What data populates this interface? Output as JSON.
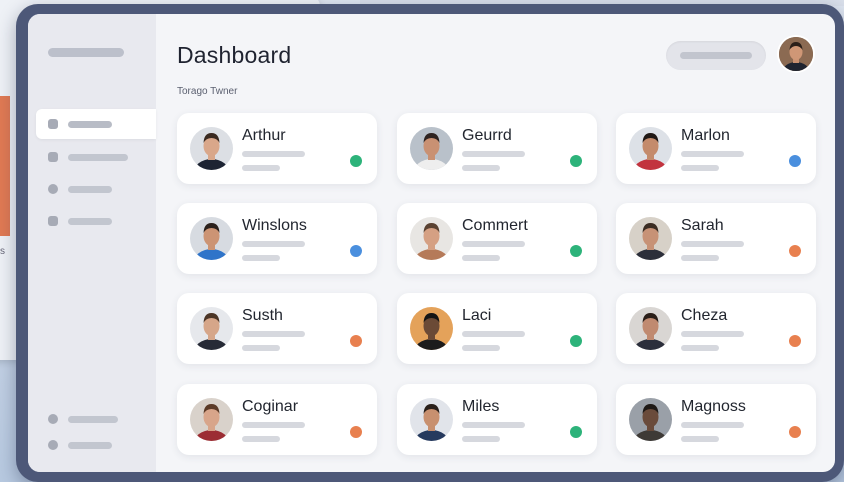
{
  "header": {
    "title": "Dashboard",
    "subtitle": "Torago Twner"
  },
  "status_colors": {
    "green": "#2db37a",
    "blue": "#4a8fde",
    "orange": "#e8804f"
  },
  "contacts": [
    {
      "name": "Arthur",
      "status": "green",
      "skin": "#d9a78a",
      "hair": "#3a2a20",
      "shirt": "#1d2433",
      "bg": "#dcdfe4"
    },
    {
      "name": "Geurrd",
      "status": "green",
      "skin": "#c99173",
      "hair": "#2e2320",
      "shirt": "#eeeeee",
      "bg": "#b9c1ca"
    },
    {
      "name": "Marlon",
      "status": "blue",
      "skin": "#c48b6c",
      "hair": "#201815",
      "shirt": "#c2333e",
      "bg": "#dde1e7"
    },
    {
      "name": "Winslons",
      "status": "blue",
      "skin": "#cc9474",
      "hair": "#2b211c",
      "shirt": "#2f74c9",
      "bg": "#d7dbe1"
    },
    {
      "name": "Commert",
      "status": "green",
      "skin": "#d5a083",
      "hair": "#5a4232",
      "shirt": "#b57a59",
      "bg": "#e8e6e3"
    },
    {
      "name": "Sarah",
      "status": "orange",
      "skin": "#c79276",
      "hair": "#3a2c22",
      "shirt": "#2c2f3a",
      "bg": "#d7d1c8"
    },
    {
      "name": "Susth",
      "status": "orange",
      "skin": "#d6a689",
      "hair": "#4b3526",
      "shirt": "#262a36",
      "bg": "#e6e8ec"
    },
    {
      "name": "Laci",
      "status": "green",
      "skin": "#6b4a36",
      "hair": "#151515",
      "shirt": "#1c1c1c",
      "bg": "#e4a25a"
    },
    {
      "name": "Cheza",
      "status": "orange",
      "skin": "#c08a70",
      "hair": "#2a1e18",
      "shirt": "#2b2e3b",
      "bg": "#d9d6d3"
    },
    {
      "name": "Coginar",
      "status": "orange",
      "skin": "#d8a58a",
      "hair": "#5b3a27",
      "shirt": "#9c2d33",
      "bg": "#d9d2cb"
    },
    {
      "name": "Miles",
      "status": "green",
      "skin": "#c8906f",
      "hair": "#2a201a",
      "shirt": "#263a5e",
      "bg": "#e1e4ea"
    },
    {
      "name": "Magnoss",
      "status": "orange",
      "skin": "#6a4b3b",
      "hair": "#1e1916",
      "shirt": "#3e3a36",
      "bg": "#9aa0a8"
    }
  ]
}
